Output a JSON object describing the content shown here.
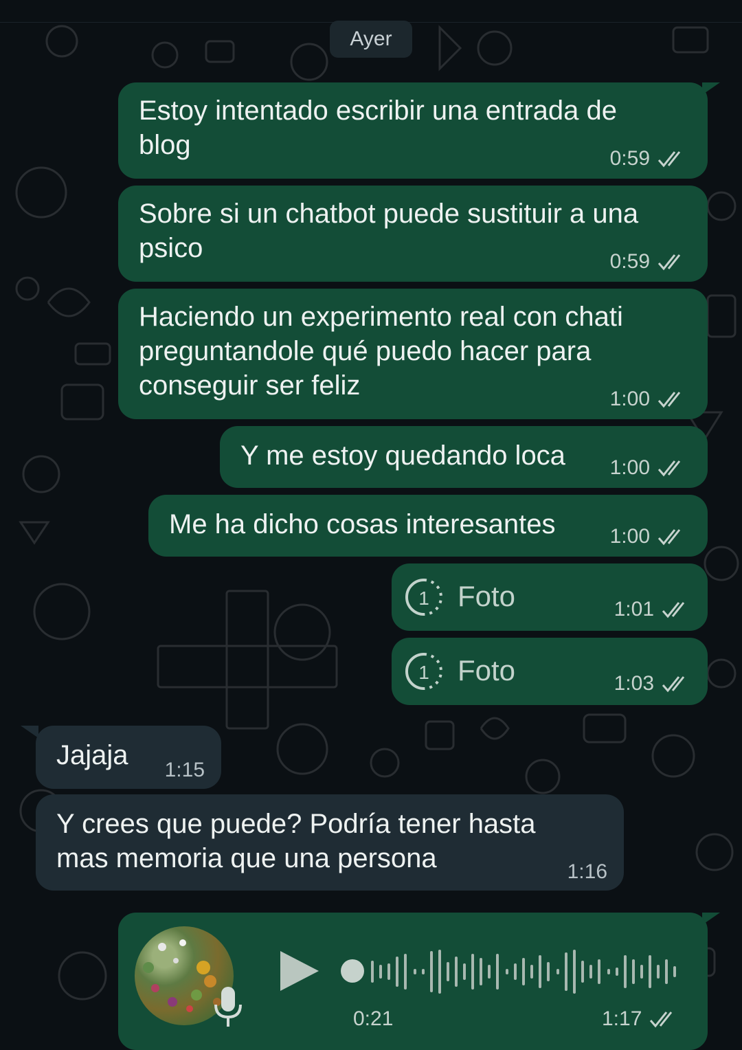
{
  "date_separator": "Ayer",
  "messages": [
    {
      "direction": "out",
      "lines": [
        "Estoy intentado escribir una entrada de",
        "blog"
      ],
      "time": "0:59",
      "status": "read"
    },
    {
      "direction": "out",
      "lines": [
        "Sobre si un chatbot puede sustituir a una",
        "psico"
      ],
      "time": "0:59",
      "status": "read"
    },
    {
      "direction": "out",
      "lines": [
        "Haciendo un experimento real con chati",
        "preguntandole qué puedo hacer para",
        "conseguir ser feliz"
      ],
      "time": "1:00",
      "status": "read"
    },
    {
      "direction": "out",
      "lines": [
        "Y me estoy quedando loca"
      ],
      "time": "1:00",
      "status": "read"
    },
    {
      "direction": "out",
      "lines": [
        "Me ha dicho cosas interesantes"
      ],
      "time": "1:00",
      "status": "read"
    },
    {
      "direction": "out",
      "type": "view-once-photo",
      "label": "Foto",
      "icon": "view-once-icon",
      "time": "1:01",
      "status": "read"
    },
    {
      "direction": "out",
      "type": "view-once-photo",
      "label": "Foto",
      "icon": "view-once-icon",
      "time": "1:03",
      "status": "read"
    },
    {
      "direction": "in",
      "lines": [
        "Jajaja"
      ],
      "time": "1:15"
    },
    {
      "direction": "in",
      "lines": [
        "Y crees que puede? Podría tener hasta",
        "mas memoria que una persona"
      ],
      "time": "1:16"
    },
    {
      "direction": "out",
      "type": "voice-note",
      "duration": "0:21",
      "time": "1:17",
      "status": "read",
      "progress": 0,
      "icons": [
        "play-icon",
        "mic-icon"
      ]
    }
  ],
  "colors": {
    "background": "#0b1014",
    "outgoing_bubble": "#134d37",
    "incoming_bubble": "#1f2c34",
    "date_chip": "#1c272d",
    "read_ticks": "#c7d3ce"
  }
}
